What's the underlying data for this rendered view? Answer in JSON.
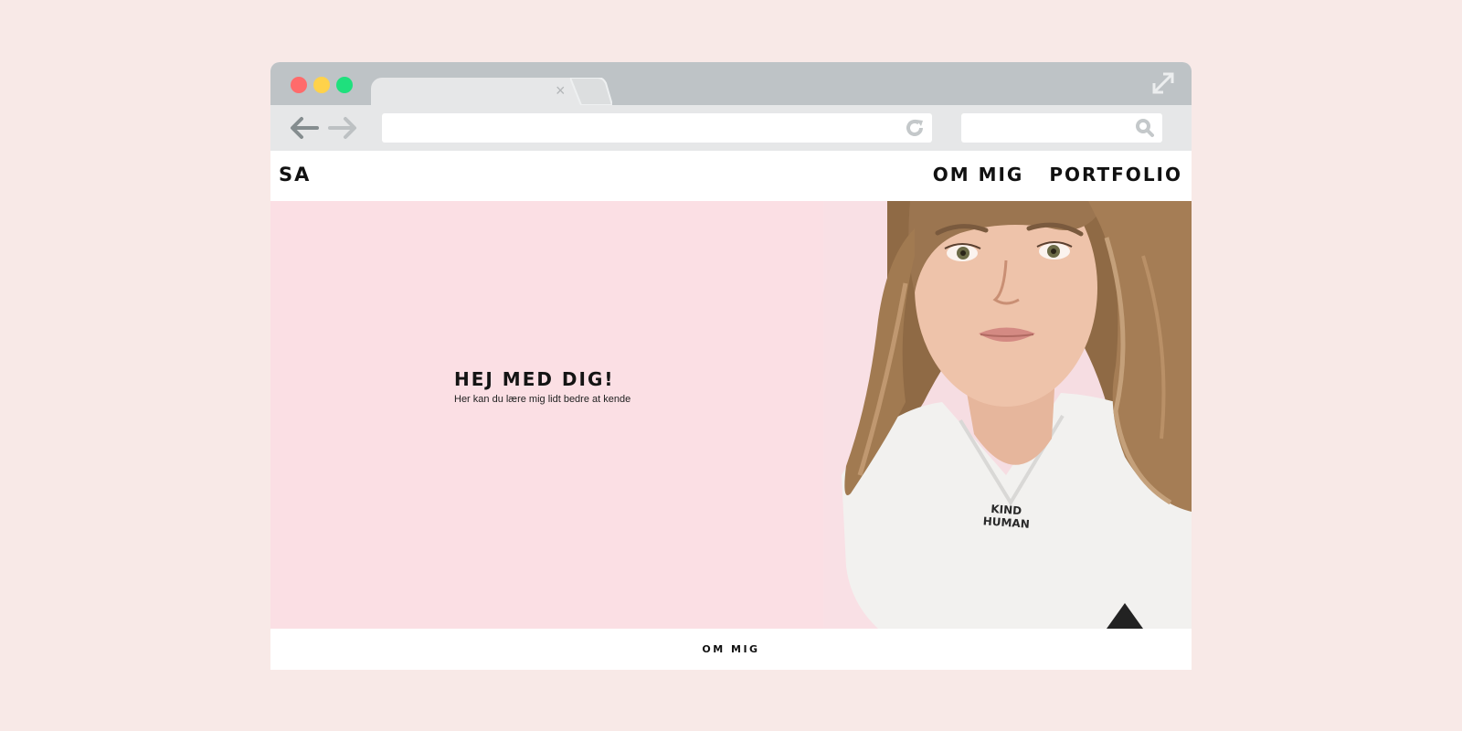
{
  "colors": {
    "background": "#f8e9e7",
    "titlebar": "#bec3c6",
    "toolbar": "#e6e7e8",
    "hero_bg": "#fbdfe4",
    "traffic_red": "#ff6b6b",
    "traffic_yellow": "#ffd24a",
    "traffic_green": "#1fe07d"
  },
  "browser": {
    "tab_close_glyph": "×",
    "icons": [
      "back-arrow-icon",
      "forward-arrow-icon",
      "reload-icon",
      "search-icon",
      "expand-icon",
      "close-icon"
    ]
  },
  "site": {
    "logo": "SA",
    "nav": [
      {
        "label": "OM MIG"
      },
      {
        "label": "PORTFOLIO"
      }
    ],
    "hero": {
      "title": "HEJ MED DIG!",
      "subtitle": "Her kan du lære mig lidt bedre at kende",
      "shirt_print": [
        "KIND",
        "HUMAN"
      ]
    },
    "footer": {
      "link": "OM MIG"
    }
  }
}
